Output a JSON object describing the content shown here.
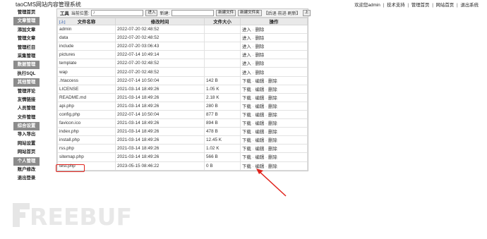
{
  "app": {
    "title": "taoCMS网站内容管理系统",
    "top_links": [
      "欢迎您admin",
      "技术支持",
      "管理首页",
      "网站首页",
      "退出系统"
    ]
  },
  "sidebar": {
    "items": [
      {
        "label": "管理首页",
        "header": false
      },
      {
        "label": "文章管理",
        "header": true
      },
      {
        "label": "添加文章",
        "header": false
      },
      {
        "label": "管理文章",
        "header": false
      },
      {
        "label": "管理栏目",
        "header": false
      },
      {
        "label": "采集管理",
        "header": false
      },
      {
        "label": "数据管理",
        "header": true
      },
      {
        "label": "执行SQL",
        "header": false
      },
      {
        "label": "其他管理",
        "header": true
      },
      {
        "label": "管理评论",
        "header": false
      },
      {
        "label": "友情链接",
        "header": false
      },
      {
        "label": "人员管理",
        "header": false
      },
      {
        "label": "文件管理",
        "header": false
      },
      {
        "label": "综合设置",
        "header": true
      },
      {
        "label": "导入导出",
        "header": false
      },
      {
        "label": "网站设置",
        "header": false
      },
      {
        "label": "网站首页",
        "header": false
      },
      {
        "label": "个人管理",
        "header": true
      },
      {
        "label": "账户修改",
        "header": false
      },
      {
        "label": "退出登录",
        "header": false
      }
    ]
  },
  "toolbar": {
    "tools_label": "工具",
    "location_label": "当前位置:",
    "location_value": "/",
    "go_button": "进入",
    "new_label": "新建:",
    "new_value": "",
    "new_file_button": "新建文件",
    "new_folder_button": "新建文件夹",
    "nav_text": "【后退·前进·刷新】",
    "up_button": "上"
  },
  "table": {
    "up_link": "[上]",
    "headers": [
      "文件名称",
      "修改时间",
      "文件大小",
      "操作"
    ],
    "rows": [
      {
        "name": "admin",
        "time": "2022-07-20 02:48:52",
        "size": "",
        "dir": true
      },
      {
        "name": "data",
        "time": "2022-07-20 02:48:52",
        "size": "",
        "dir": true
      },
      {
        "name": "include",
        "time": "2022-07-20 03:06:43",
        "size": "",
        "dir": true
      },
      {
        "name": "pictures",
        "time": "2022-07-14 10:49:14",
        "size": "",
        "dir": true
      },
      {
        "name": "template",
        "time": "2022-07-20 02:48:52",
        "size": "",
        "dir": true
      },
      {
        "name": "wap",
        "time": "2022-07-20 02:48:52",
        "size": "",
        "dir": true
      },
      {
        "name": ".htaccess",
        "time": "2022-07-14 10:50:04",
        "size": "142 B",
        "dir": false
      },
      {
        "name": "LICENSE",
        "time": "2021-03-14 18:49:26",
        "size": "1.05 K",
        "dir": false
      },
      {
        "name": "README.md",
        "time": "2021-03-14 18:49:26",
        "size": "2.18 K",
        "dir": false
      },
      {
        "name": "api.php",
        "time": "2021-03-14 18:49:26",
        "size": "280 B",
        "dir": false
      },
      {
        "name": "config.php",
        "time": "2022-07-14 10:50:04",
        "size": "877 B",
        "dir": false
      },
      {
        "name": "favicon.ico",
        "time": "2021-03-14 18:49:26",
        "size": "894 B",
        "dir": false
      },
      {
        "name": "index.php",
        "time": "2021-03-14 18:49:26",
        "size": "478 B",
        "dir": false
      },
      {
        "name": "install.php",
        "time": "2021-03-14 18:49:26",
        "size": "12.45 K",
        "dir": false
      },
      {
        "name": "rss.php",
        "time": "2021-03-14 18:49:26",
        "size": "1.02 K",
        "dir": false
      },
      {
        "name": "sitemap.php",
        "time": "2021-03-14 18:49:26",
        "size": "566 B",
        "dir": false
      },
      {
        "name": "test.php",
        "time": "2023-05-15 08:46:22",
        "size": "0 B",
        "dir": false
      }
    ],
    "dir_actions": [
      "进入",
      "删除"
    ],
    "file_actions": [
      "下载",
      "编辑",
      "删除"
    ]
  },
  "watermark": {
    "text": "REEBUF"
  },
  "colors": {
    "sidebar_header_bg": "#8c8c8c",
    "annotation_red": "#e0231c",
    "watermark": "#e8e8e8"
  }
}
